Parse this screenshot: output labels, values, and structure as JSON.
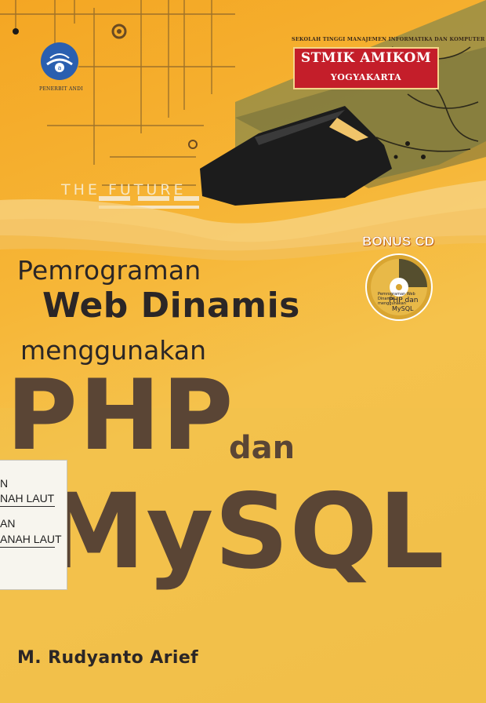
{
  "publisher": {
    "name": "PENERBIT ANDI",
    "logo_icon": "publisher-globe-icon"
  },
  "institute": {
    "line": "SEKOLAH TINGGI MANAJEMEN INFORMATIKA  DAN  KOMPUTER",
    "name": "STMIK AMIKOM",
    "city": "YOGYAKARTA",
    "box_color": "#c41e2a"
  },
  "tagline": "THE FUTURE",
  "bonus": {
    "label": "BONUS CD",
    "cd_line_1": "Pemrograman Web Dinamis menggunakan",
    "cd_line_2": "PHP dan",
    "cd_line_3": "MySQL"
  },
  "title": {
    "line1": "Pemrograman",
    "line2": "Web Dinamis",
    "line3": "menggunakan",
    "big1": "PHP",
    "connector": "dan",
    "big2": "MySQL"
  },
  "library_sticker": {
    "line1": "N",
    "line2": "NAH LAUT",
    "line3": "AN",
    "line4": "ANAH LAUT"
  },
  "author": "M. Rudyanto Arief",
  "colors": {
    "background": "#f4b335",
    "title_text": "#2b2626",
    "big_text": "#5a4535",
    "accent_red": "#c41e2a"
  }
}
